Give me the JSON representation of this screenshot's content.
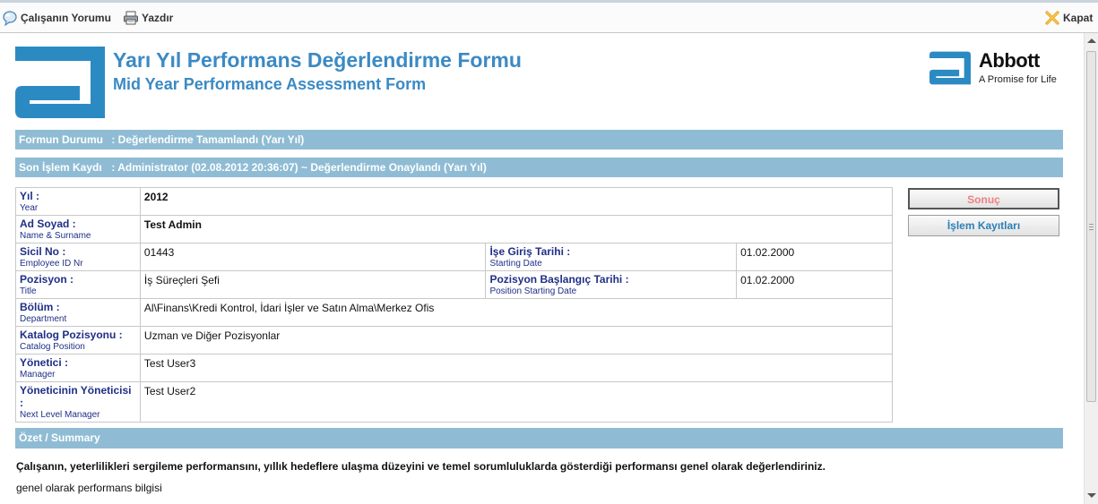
{
  "toolbar": {
    "comment_label": "Çalışanın Yorumu",
    "print_label": "Yazdır",
    "close_label": "Kapat"
  },
  "header": {
    "title_tr": "Yarı Yıl Performans Değerlendirme Formu",
    "title_en": "Mid Year Performance Assessment Form",
    "brand_name": "Abbott",
    "brand_tagline": "A Promise for Life"
  },
  "status": {
    "form_status_label": "Formun Durumu",
    "form_status_value": ": Değerlendirme Tamamlandı (Yarı Yıl)",
    "last_log_label": "Son İşlem Kaydı",
    "last_log_value": ": Administrator (02.08.2012 20:36:07) ~ Değerlendirme Onaylandı (Yarı Yıl)"
  },
  "info": {
    "year": {
      "label": "Yıl :",
      "sub": "Year",
      "value": "2012"
    },
    "name": {
      "label": "Ad Soyad :",
      "sub": "Name & Surname",
      "value": "Test Admin"
    },
    "employee_id": {
      "label": "Sicil No :",
      "sub": "Employee ID Nr",
      "value": "01443"
    },
    "start_date": {
      "label": "İşe Giriş Tarihi :",
      "sub": "Starting Date",
      "value": "01.02.2000"
    },
    "position": {
      "label": "Pozisyon :",
      "sub": "Title",
      "value": "İş Süreçleri Şefi"
    },
    "position_start": {
      "label": "Pozisyon Başlangıç Tarihi :",
      "sub": "Position Starting Date",
      "value": "01.02.2000"
    },
    "department": {
      "label": "Bölüm :",
      "sub": "Department",
      "value": "Al\\Finans\\Kredi Kontrol, İdari İşler ve Satın Alma\\Merkez Ofis"
    },
    "catalog_position": {
      "label": "Katalog Pozisyonu :",
      "sub": "Catalog Position",
      "value": "Uzman ve Diğer Pozisyonlar"
    },
    "manager": {
      "label": "Yönetici :",
      "sub": "Manager",
      "value": "Test User3"
    },
    "next_manager": {
      "label": "Yöneticinin Yöneticisi :",
      "sub": "Next Level Manager",
      "value": "Test User2"
    }
  },
  "buttons": {
    "result_label": "Sonuç",
    "log_label": "İşlem Kayıtları"
  },
  "summary": {
    "header": "Özet / Summary",
    "question": "Çalışanın, yeterlilikleri sergileme performansını, yıllık hedeflere ulaşma düzeyini ve temel sorumluluklarda gösterdiği performansı genel olarak değerlendiriniz.",
    "answer": "genel olarak performans bilgisi"
  },
  "colors": {
    "accent": "#3b8ac4",
    "bar": "#8fbcd4",
    "label": "#1f2f86",
    "result_button_text": "#f08080",
    "log_button_text": "#2a80b9"
  }
}
